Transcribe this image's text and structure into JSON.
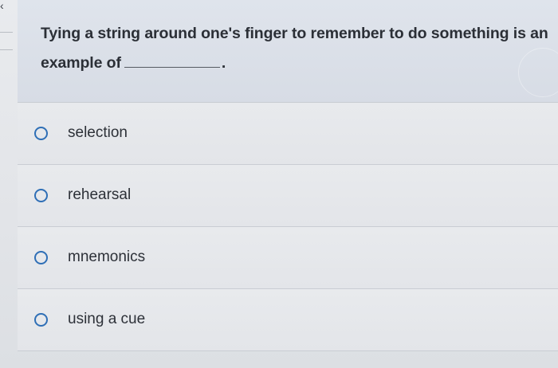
{
  "question": {
    "text_before": "Tying a string around one's finger to remember to do something is an example of",
    "text_after": "."
  },
  "options": [
    {
      "label": "selection"
    },
    {
      "label": "rehearsal"
    },
    {
      "label": "mnemonics"
    },
    {
      "label": "using a cue"
    }
  ],
  "colors": {
    "radio_border": "#2f6fb6",
    "text": "#2d3138",
    "background": "#e4e6ea"
  }
}
